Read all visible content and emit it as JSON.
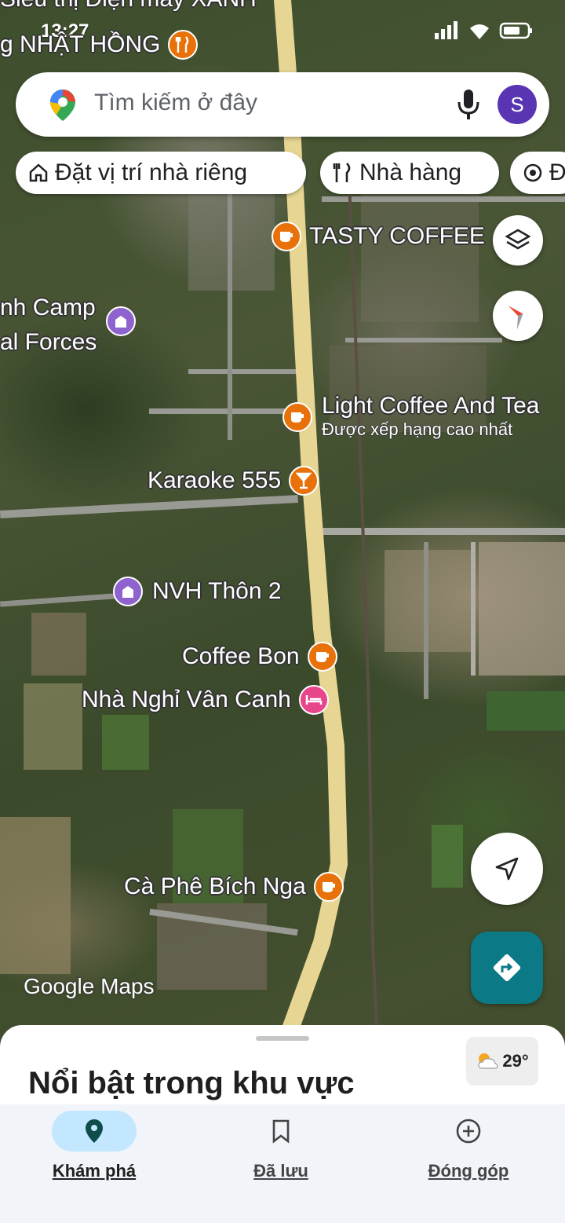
{
  "status_bar": {
    "time": "13:27"
  },
  "search": {
    "placeholder": "Tìm kiếm ở đây",
    "avatar_letter": "S"
  },
  "chips": [
    {
      "label": "Đặt vị trí nhà riêng",
      "icon": "home-icon"
    },
    {
      "label": "Nhà hàng",
      "icon": "restaurant-icon"
    },
    {
      "label": "Đ",
      "icon": "attraction-icon"
    }
  ],
  "map": {
    "top_labels": {
      "market": "Siêu thị Điện máy XANH",
      "restaurant": "g NHẬT HỒNG"
    },
    "pois": [
      {
        "label": "TASTY COFFEE",
        "icon": "coffee-icon",
        "color": "#e8710a"
      },
      {
        "label": "nh Camp\nal Forces",
        "icon": "landmark-icon",
        "color": "#8e63ce"
      },
      {
        "label": "Light Coffee And Tea",
        "sublabel": "Được xếp hạng cao nhất",
        "icon": "coffee-icon",
        "color": "#e8710a"
      },
      {
        "label": "Karaoke 555",
        "icon": "bar-icon",
        "color": "#e8710a"
      },
      {
        "label": "NVH Thôn 2",
        "icon": "landmark-icon",
        "color": "#8e63ce"
      },
      {
        "label": "Coffee Bon",
        "icon": "coffee-icon",
        "color": "#e8710a"
      },
      {
        "label": "Nhà Nghỉ Vân Canh",
        "icon": "hotel-icon",
        "color": "#e8468a"
      },
      {
        "label": "Cà Phê Bích Nga",
        "icon": "coffee-icon",
        "color": "#e8710a"
      }
    ],
    "watermark": "Google Maps"
  },
  "sheet": {
    "title": "Nổi bật trong khu vực"
  },
  "weather": {
    "temp": "29°"
  },
  "nav": [
    {
      "label": "Khám phá",
      "icon": "explore-pin-icon",
      "active": true
    },
    {
      "label": "Đã lưu",
      "icon": "bookmark-icon",
      "active": false
    },
    {
      "label": "Đóng góp",
      "icon": "add-circle-icon",
      "active": false
    }
  ],
  "colors": {
    "accent": "#0b57d0",
    "directions": "#0b7a86",
    "active_pill": "#c2e7ff"
  }
}
